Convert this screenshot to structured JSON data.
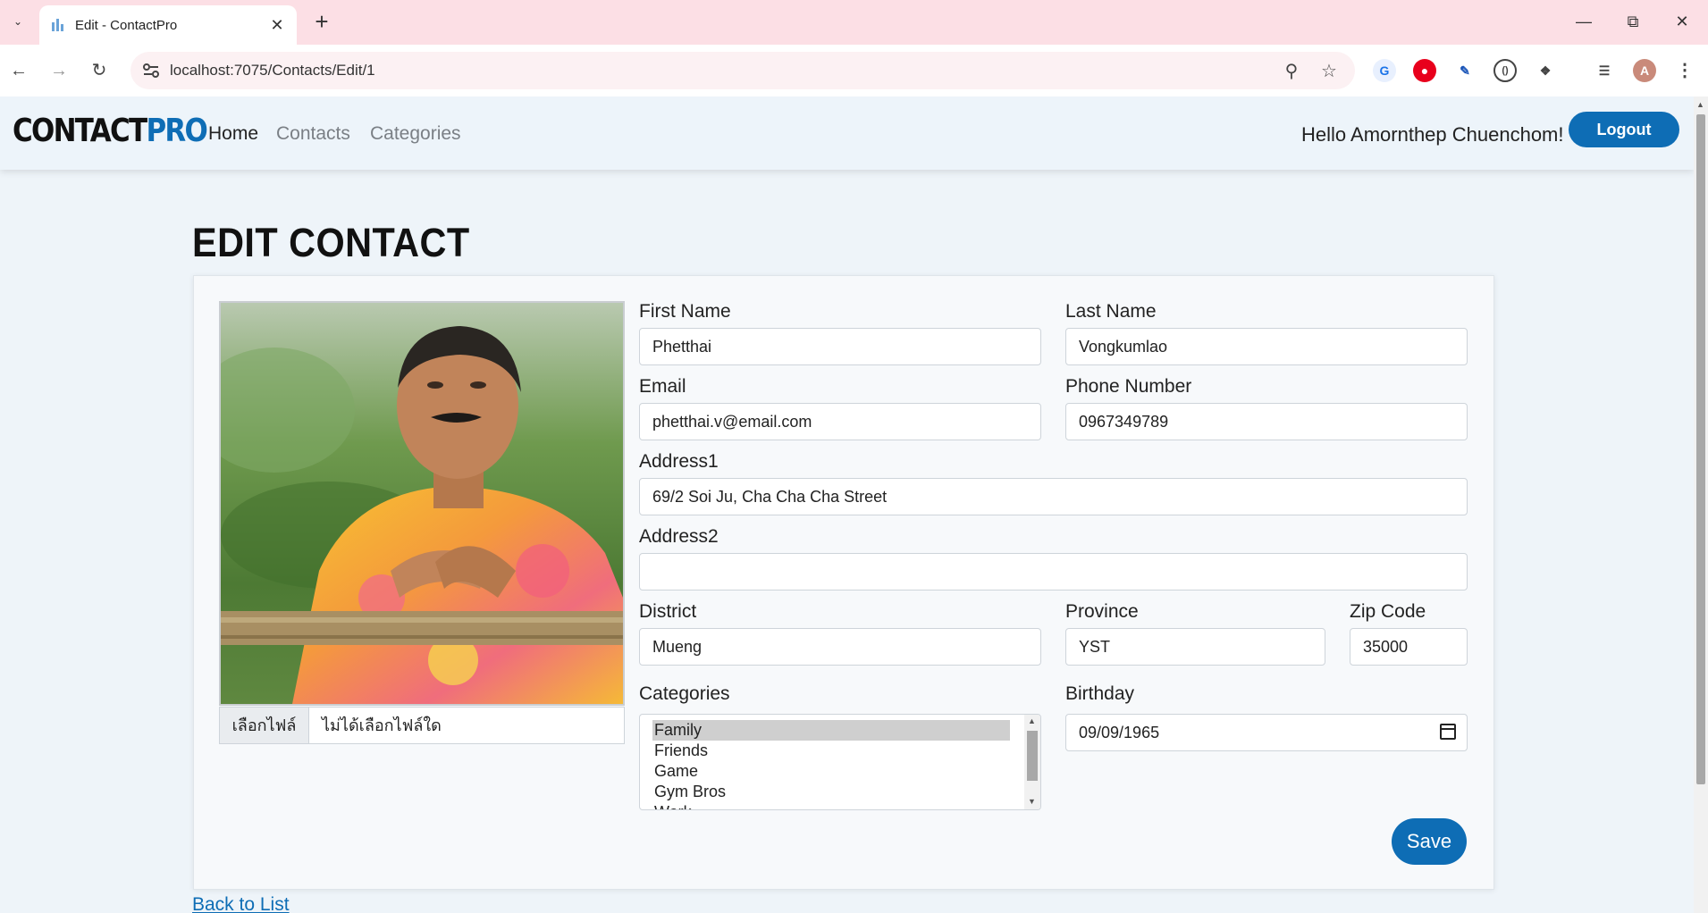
{
  "browser": {
    "tab_title": "Edit - ContactPro",
    "url": "localhost:7075/Contacts/Edit/1"
  },
  "nav": {
    "brand_part1": "CONTACT",
    "brand_part2": "PRO",
    "links": [
      "Home",
      "Contacts",
      "Categories"
    ],
    "greeting": "Hello Amornthep Chuenchom!",
    "logout_label": "Logout"
  },
  "page": {
    "title": "EDIT CONTACT",
    "back_link": "Back to List"
  },
  "form": {
    "file_button": "เลือกไฟล์",
    "file_status": "ไม่ได้เลือกไฟล์ใด",
    "first_name_label": "First Name",
    "first_name": "Phetthai",
    "last_name_label": "Last Name",
    "last_name": "Vongkumlao",
    "email_label": "Email",
    "email": "phetthai.v@email.com",
    "phone_label": "Phone Number",
    "phone": "0967349789",
    "address1_label": "Address1",
    "address1": "69/2 Soi Ju, Cha Cha Cha Street",
    "address2_label": "Address2",
    "address2": "",
    "district_label": "District",
    "district": "Mueng",
    "province_label": "Province",
    "province": "YST",
    "zip_label": "Zip Code",
    "zip": "35000",
    "categories_label": "Categories",
    "categories": [
      "Family",
      "Friends",
      "Game",
      "Gym Bros",
      "Work"
    ],
    "selected_category": "Family",
    "birthday_label": "Birthday",
    "birthday": "09/09/1965",
    "save_label": "Save"
  },
  "colors": {
    "accent": "#0e6db5",
    "tabbar": "#fcdfe5",
    "page_bg": "#eef4f9"
  }
}
